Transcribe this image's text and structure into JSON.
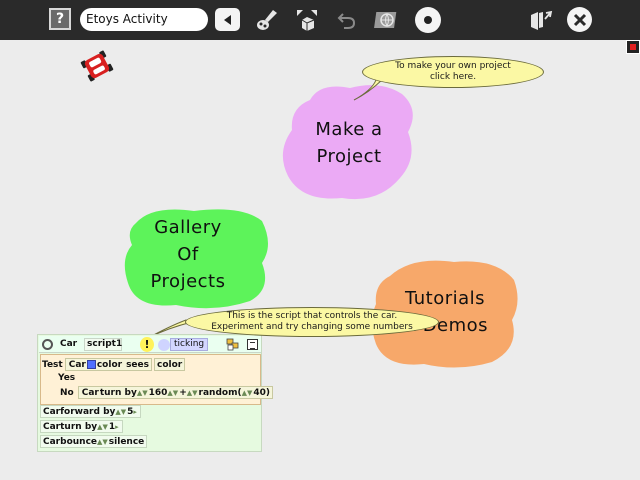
{
  "toolbar": {
    "help_label": "?",
    "activity_title": "Etoys Activity",
    "icons": [
      "help-icon",
      "back-icon",
      "paint-icon",
      "supplies-icon",
      "undo-icon",
      "language-globe-icon",
      "stop-icon",
      "share-icon",
      "close-icon"
    ]
  },
  "balloons": {
    "make_project": [
      "To make your own project",
      "click here."
    ],
    "script_hint": [
      "This is the script that controls the car.",
      "Experiment and try changing some numbers"
    ]
  },
  "blobs": {
    "make_project": {
      "lines": [
        "Make a",
        "Project"
      ],
      "color": "#ebaaf5"
    },
    "gallery": {
      "lines": [
        "Gallery",
        "Of",
        "Projects"
      ],
      "color": "#5df35a"
    },
    "tutorials": {
      "lines": [
        "Tutorials",
        "& Demos"
      ],
      "color": "#f7a86a"
    }
  },
  "script": {
    "player": "Car",
    "name": "script1",
    "status": "ticking",
    "test": {
      "label": "Test",
      "object": "Car",
      "property": "color",
      "verb": "sees",
      "target_label": "color",
      "yes_label": "Yes",
      "no_label": "No",
      "no_object": "Car",
      "no_command": "turn by",
      "no_value": "160",
      "plus": "+",
      "random_label": "random",
      "paren_open": "(",
      "random_value": "40",
      "paren_close": ")"
    },
    "commands": [
      {
        "object": "Car",
        "command": "forward by",
        "value": "5"
      },
      {
        "object": "Car",
        "command": "turn by",
        "value": "1"
      },
      {
        "object": "Car",
        "command": "bounce",
        "value": "silence"
      }
    ]
  },
  "colors": {
    "toolbar": "#2a2a2a",
    "background": "#ececec",
    "balloon": "#fbf8a4",
    "car": "#d82020",
    "test_swatch": "#4f6fff"
  }
}
